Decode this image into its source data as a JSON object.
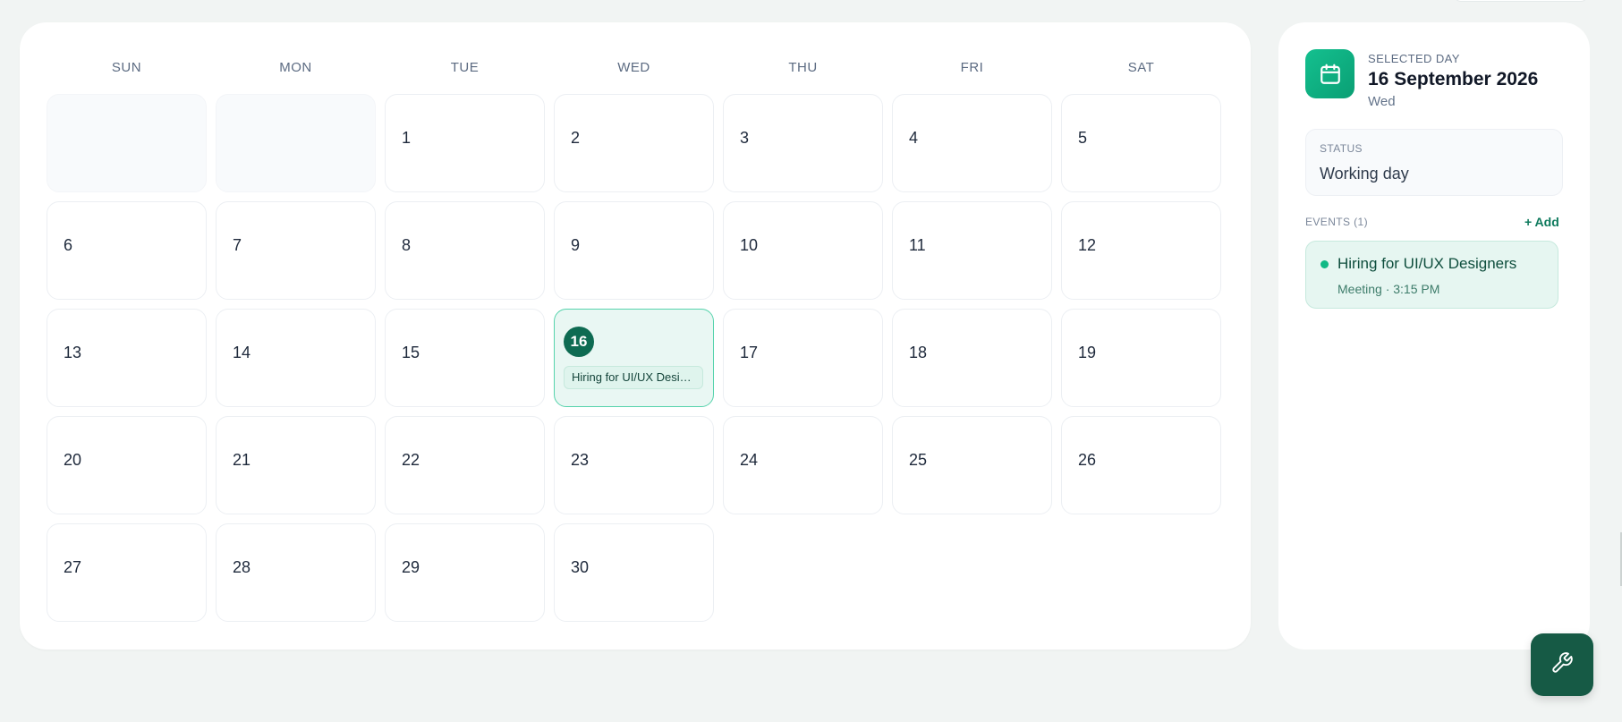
{
  "calendar": {
    "weekdays": [
      "SUN",
      "MON",
      "TUE",
      "WED",
      "THU",
      "FRI",
      "SAT"
    ],
    "days": [
      "1",
      "2",
      "3",
      "4",
      "5",
      "6",
      "7",
      "8",
      "9",
      "10",
      "11",
      "12",
      "13",
      "14",
      "15",
      "16",
      "17",
      "18",
      "19",
      "20",
      "21",
      "22",
      "23",
      "24",
      "25",
      "26",
      "27",
      "28",
      "29",
      "30"
    ],
    "selected_event_preview": "Hiring for UI/UX Designers"
  },
  "side": {
    "selected_label": "SELECTED DAY",
    "selected_date": "16 September 2026",
    "selected_weekday": "Wed",
    "status_label": "STATUS",
    "status_value": "Working day",
    "events_label": "EVENTS (1)",
    "add_label": "+ Add",
    "events": [
      {
        "title": "Hiring for UI/UX Designers",
        "meta": "Meeting · 3:15 PM"
      }
    ]
  },
  "icons": {
    "calendar": "calendar-icon",
    "tools": "wrench-icon"
  },
  "colors": {
    "accent": "#0e6b52",
    "accent_light": "#e9f7f3",
    "fab": "#165a45"
  }
}
